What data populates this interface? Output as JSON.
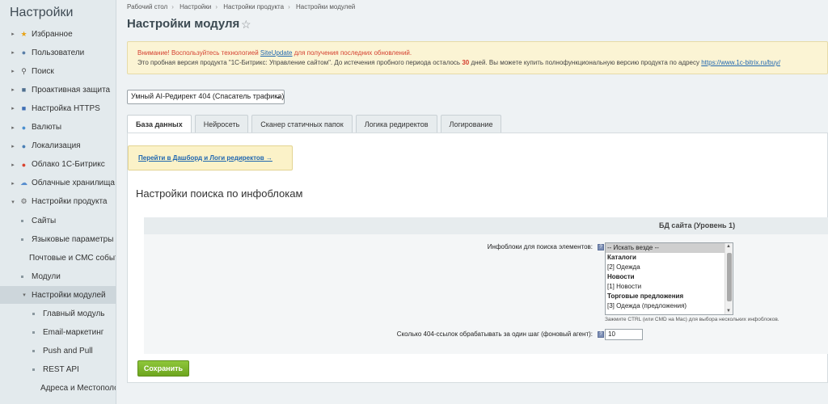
{
  "sidebar": {
    "title": "Настройки",
    "items": [
      {
        "label": "Избранное",
        "icon": "star-icon",
        "glyph": "★",
        "color": "#e8a317",
        "level": 0
      },
      {
        "label": "Пользователи",
        "icon": "user-icon",
        "glyph": "●",
        "color": "#5a7fa8",
        "level": 0
      },
      {
        "label": "Поиск",
        "icon": "search-icon",
        "glyph": "⚲",
        "color": "#555555",
        "level": 0
      },
      {
        "label": "Проактивная защита",
        "icon": "shield-icon",
        "glyph": "■",
        "color": "#4f6f8f",
        "level": 0
      },
      {
        "label": "Настройка HTTPS",
        "icon": "lock-icon",
        "glyph": "■",
        "color": "#3f6fb5",
        "level": 0
      },
      {
        "label": "Валюты",
        "icon": "currency-icon",
        "glyph": "●",
        "color": "#4a8fcf",
        "level": 0
      },
      {
        "label": "Локализация",
        "icon": "globe-icon",
        "glyph": "●",
        "color": "#4a7fb5",
        "level": 0
      },
      {
        "label": "Облако 1С-Битрикс",
        "icon": "cloud-bitrix-icon",
        "glyph": "●",
        "color": "#d9432f",
        "level": 0
      },
      {
        "label": "Облачные хранилища",
        "icon": "cloud-storage-icon",
        "glyph": "☁",
        "color": "#5a8fcf",
        "level": 0
      },
      {
        "label": "Настройки продукта",
        "icon": "gear-icon",
        "glyph": "⚙",
        "color": "#666666",
        "level": 0,
        "expanded": true
      },
      {
        "label": "Сайты",
        "level": 1
      },
      {
        "label": "Языковые параметры",
        "level": 1
      },
      {
        "label": "Почтовые и СМС события",
        "level": 1
      },
      {
        "label": "Модули",
        "level": 1
      },
      {
        "label": "Настройки модулей",
        "level": 1,
        "expanded": true,
        "active": true
      },
      {
        "label": "Главный модуль",
        "level": 2
      },
      {
        "label": "Email-маркетинг",
        "level": 2
      },
      {
        "label": "Push and Pull",
        "level": 2
      },
      {
        "label": "REST API",
        "level": 2
      },
      {
        "label": "Адреса и Местоположения",
        "level": 2
      }
    ]
  },
  "breadcrumbs": [
    "Рабочий стол",
    "Настройки",
    "Настройки продукта",
    "Настройки модулей"
  ],
  "page_title": "Настройки модуля",
  "notice": {
    "warning_pre": "Внимание! Воспользуйтесь технологией ",
    "warning_link": "SiteUpdate",
    "warning_post": " для получения последних обновлений.",
    "trial_pre": "Это пробная версия продукта \"1С-Битрикс: Управление сайтом\". До истечения пробного периода осталось ",
    "trial_days": "30",
    "trial_mid": " дней. Вы можете купить полнофункциональную версию продукта по адресу ",
    "trial_link": "https://www.1c-bitrix.ru/buy/"
  },
  "module_select": {
    "value": "Умный AI-Редирект 404 (Спасатель трафика)"
  },
  "tabs": [
    "База данных",
    "Нейросеть",
    "Сканер статичных папок",
    "Логика редиректов",
    "Логирование"
  ],
  "active_tab": 0,
  "dashboard_link": "Перейти в Дашборд и Логи редиректов →",
  "section_title": "Настройки поиска по инфоблокам",
  "group_header": "БД сайта (Уровень 1)",
  "fields": {
    "iblocks_label": "Инфоблоки для поиска элементов:",
    "iblocks_options": [
      {
        "text": "-- Искать везде --",
        "selected": true,
        "group": false
      },
      {
        "text": "Каталоги",
        "selected": false,
        "group": true
      },
      {
        "text": "[2] Одежда",
        "selected": false,
        "group": false
      },
      {
        "text": "Новости",
        "selected": false,
        "group": true
      },
      {
        "text": "[1] Новости",
        "selected": false,
        "group": false
      },
      {
        "text": "Торговые предложения",
        "selected": false,
        "group": true
      },
      {
        "text": "[3] Одежда (предложения)",
        "selected": false,
        "group": false
      }
    ],
    "iblocks_hint": "Зажмите CTRL (или CMD на Mac) для выбора нескольких инфоблоков.",
    "batch_label": "Сколько 404-ссылок обрабатывать за один шаг (фоновый агент):",
    "batch_value": "10",
    "help_glyph": "?"
  },
  "save_label": "Сохранить"
}
